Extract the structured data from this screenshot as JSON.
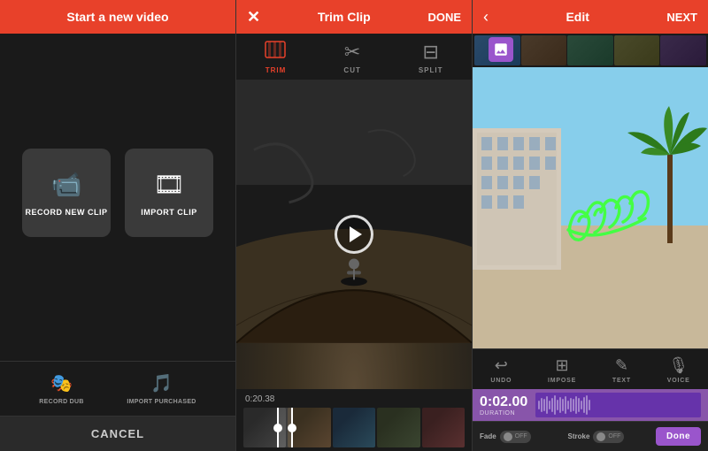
{
  "panel1": {
    "header": {
      "title": "Start a new video"
    },
    "buttons": [
      {
        "id": "record-new-clip",
        "icon": "🎥",
        "label": "RECORD NEW CLIP"
      },
      {
        "id": "import-clip",
        "icon": "🎞",
        "label": "IMPORT CLIP"
      }
    ],
    "bottom_buttons": [
      {
        "id": "record-dub",
        "icon": "🎭",
        "label": "RECORD DUB"
      },
      {
        "id": "import-purchased",
        "icon": "🎵",
        "label": "IMPORT PURCHASED"
      }
    ],
    "cancel_label": "CANCEL"
  },
  "panel2": {
    "header": {
      "title": "Trim Clip",
      "done_label": "DONE"
    },
    "tabs": [
      {
        "id": "trim",
        "label": "TRIM",
        "active": true
      },
      {
        "id": "cut",
        "label": "CUT",
        "active": false
      },
      {
        "id": "split",
        "label": "SPLIT",
        "active": false
      }
    ],
    "timeline": {
      "time": "0:20.38"
    }
  },
  "panel3": {
    "header": {
      "title": "Edit",
      "next_label": "NEXT"
    },
    "tools": [
      {
        "id": "undo",
        "icon": "↩",
        "label": "UNDO"
      },
      {
        "id": "impose",
        "icon": "⊞",
        "label": "IMPOSE"
      },
      {
        "id": "text",
        "icon": "✎",
        "label": "TEXT"
      },
      {
        "id": "voice",
        "icon": "🎙",
        "label": "VOICE"
      }
    ],
    "duration": {
      "time": "0:02.00",
      "label": "DURATION"
    },
    "fade": {
      "label": "Fade",
      "state": "OFF"
    },
    "stroke": {
      "label": "Stroke",
      "state": "OFF"
    },
    "done_label": "Done"
  }
}
